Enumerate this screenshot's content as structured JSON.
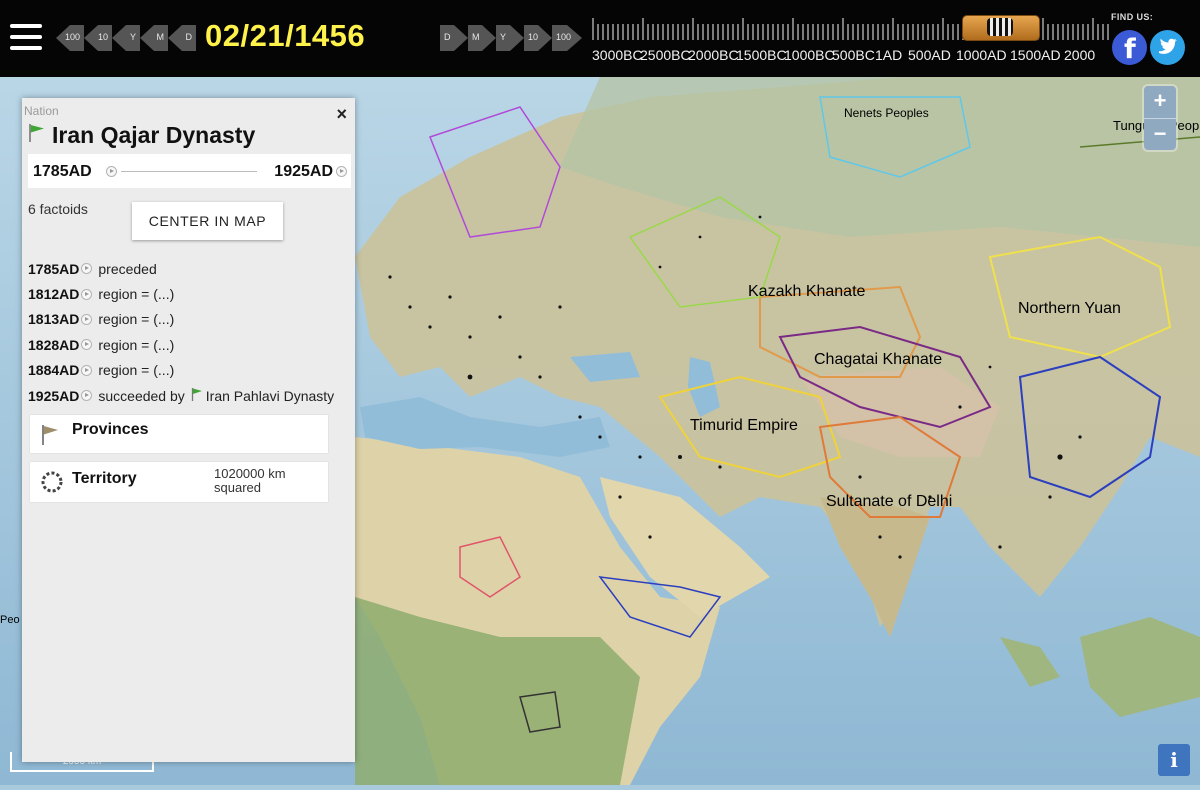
{
  "header": {
    "back_steps": [
      "100",
      "10",
      "Y",
      "M",
      "D"
    ],
    "current_date": "02/21/1456",
    "forward_steps": [
      "D",
      "M",
      "Y",
      "10",
      "100"
    ],
    "timeline_years": [
      "3000BC",
      "2500BC",
      "2000BC",
      "1500BC",
      "1000BC",
      "500BC",
      "1AD",
      "500AD",
      "1000AD",
      "1500AD",
      "2000"
    ],
    "find_us": "FIND US:",
    "social": {
      "facebook_glyph": "f"
    }
  },
  "map": {
    "labels": [
      {
        "text": "Kazakh Khanate",
        "color": "#e09a4a"
      },
      {
        "text": "Northern Yuan",
        "color": "#e8d25a"
      },
      {
        "text": "Chagatai Khanate",
        "color": "#8a3a8a"
      },
      {
        "text": "Timurid Empire",
        "color": "#e6c64a"
      },
      {
        "text": "Sultanate of Delhi",
        "color": "#e07a38"
      },
      {
        "text": "Tungusic Peop",
        "color": "#7fa84a"
      },
      {
        "text": "Nenets Peoples",
        "color": "#5fb8d8"
      },
      {
        "text": "Peo",
        "color": "#9fb5c8"
      }
    ],
    "zoom_in": "+",
    "zoom_out": "−",
    "info": "i",
    "scale": "2000 km"
  },
  "panel": {
    "eyebrow": "Nation",
    "close": "×",
    "title": "Iran Qajar Dynasty",
    "start": "1785AD",
    "end": "1925AD",
    "factoids": "6 factoids",
    "center_button": "CENTER IN MAP",
    "events": [
      {
        "year": "1785AD",
        "text": "preceded"
      },
      {
        "year": "1812AD",
        "text": "region = (...)"
      },
      {
        "year": "1813AD",
        "text": "region = (...)"
      },
      {
        "year": "1828AD",
        "text": "region = (...)"
      },
      {
        "year": "1884AD",
        "text": "region = (...)"
      },
      {
        "year": "1925AD",
        "text": "succeeded by",
        "link": "Iran Pahlavi Dynasty"
      }
    ],
    "provinces_label": "Provinces",
    "territory_label": "Territory",
    "territory_value": "1020000 km squared"
  },
  "colors": {
    "date": "#fff24a",
    "topbar": "#050505",
    "flag": "#3fa535"
  }
}
